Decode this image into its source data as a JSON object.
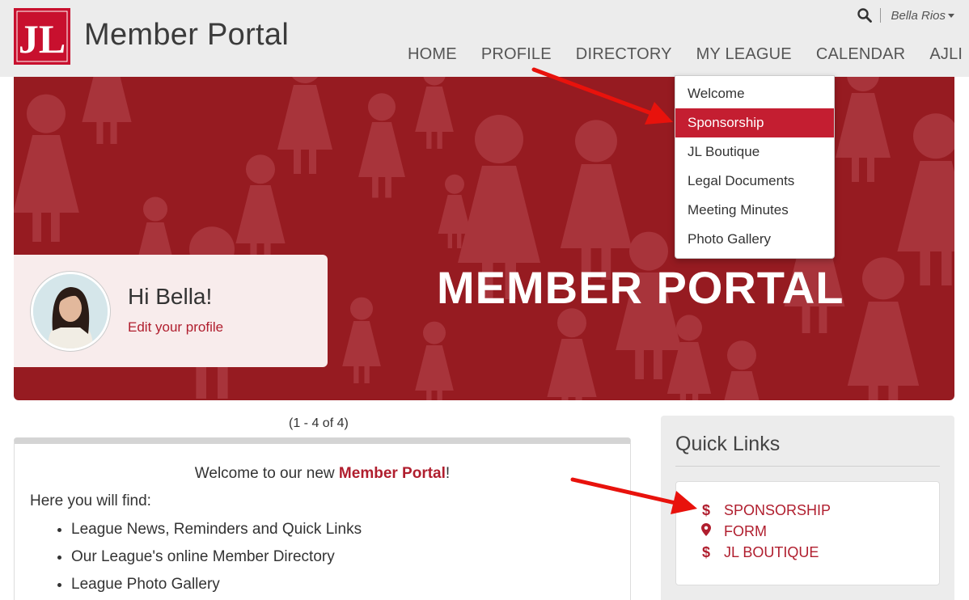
{
  "header": {
    "logo_text": "JL",
    "title": "Member Portal",
    "user_name": "Bella Rios",
    "icons": {
      "search": "search-icon",
      "user_menu": "caret-down-icon"
    }
  },
  "nav": {
    "items": [
      "HOME",
      "PROFILE",
      "DIRECTORY",
      "MY LEAGUE",
      "CALENDAR",
      "AJLI"
    ]
  },
  "dropdown": {
    "items": [
      "Welcome",
      "Sponsorship",
      "JL Boutique",
      "Legal Documents",
      "Meeting Minutes",
      "Photo Gallery"
    ],
    "selected": "Sponsorship"
  },
  "hero": {
    "title": "MEMBER PORTAL",
    "greeting": "Hi Bella!",
    "edit_link": "Edit your profile"
  },
  "content": {
    "pager": "(1 - 4 of 4)",
    "welcome_prefix": "Welcome to our new ",
    "welcome_brand": "Member Portal",
    "welcome_suffix": "!",
    "find_label": "Here you will find:",
    "bullets": [
      "League News, Reminders and Quick Links",
      "Our League's online Member Directory",
      "League Photo Gallery"
    ]
  },
  "quick_links": {
    "title": "Quick Links",
    "items": [
      {
        "label": "SPONSORSHIP",
        "icon": "dollar-icon",
        "glyph": "$"
      },
      {
        "label": "FORM",
        "icon": "map-pin-icon",
        "glyph": ""
      },
      {
        "label": "JL BOUTIQUE",
        "icon": "dollar-icon",
        "glyph": "$"
      }
    ]
  },
  "colors": {
    "brand_red": "#c8102e",
    "hero_bg": "#961b21",
    "link_red": "#b01e2e",
    "active_item": "#c41e31",
    "header_bg": "#ececec",
    "arrow": "#e8120c"
  }
}
